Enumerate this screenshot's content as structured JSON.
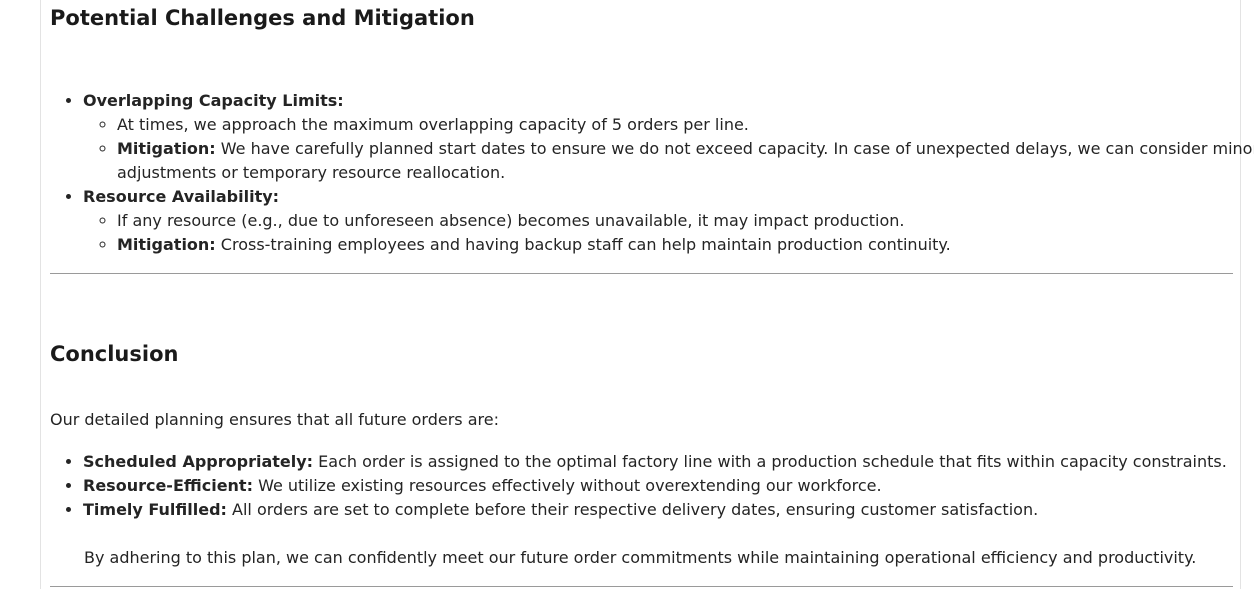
{
  "challenges": {
    "title": "Potential Challenges and Mitigation",
    "items": [
      {
        "label": "Overlapping Capacity Limits:",
        "sub": [
          {
            "label": "",
            "text": "At times, we approach the maximum overlapping capacity of 5 orders per line."
          },
          {
            "label": "Mitigation:",
            "text": " We have carefully planned start dates to ensure we do not exceed capacity. In case of unexpected delays, we can consider minor adjustments or temporary resource reallocation."
          }
        ]
      },
      {
        "label": "Resource Availability:",
        "sub": [
          {
            "label": "",
            "text": "If any resource (e.g., due to unforeseen absence) becomes unavailable, it may impact production."
          },
          {
            "label": "Mitigation:",
            "text": " Cross-training employees and having backup staff can help maintain production continuity."
          }
        ]
      }
    ]
  },
  "conclusion": {
    "title": "Conclusion",
    "intro": "Our detailed planning ensures that all future orders are:",
    "items": [
      {
        "label": "Scheduled Appropriately:",
        "text": " Each order is assigned to the optimal factory line with a production schedule that fits within capacity constraints."
      },
      {
        "label": "Resource-Efficient:",
        "text": " We utilize existing resources effectively without overextending our workforce."
      },
      {
        "label": "Timely Fulfilled:",
        "text": " All orders are set to complete before their respective delivery dates, ensuring customer satisfaction."
      }
    ],
    "closing": "By adhering to this plan, we can confidently meet our future order commitments while maintaining operational efficiency and productivity."
  }
}
